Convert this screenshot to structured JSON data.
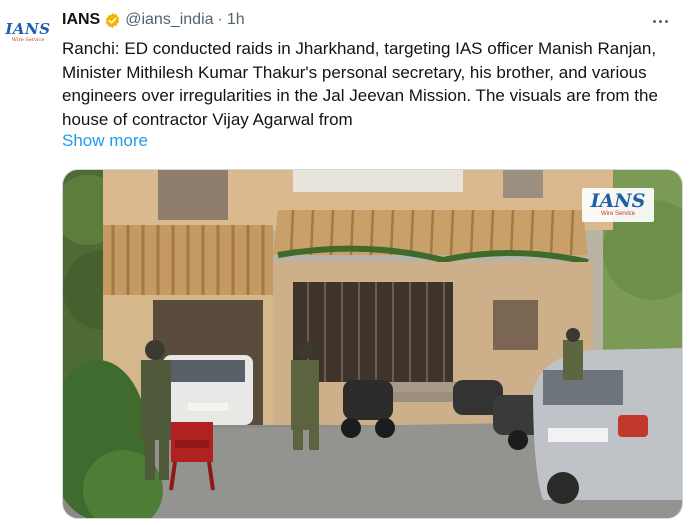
{
  "author": {
    "avatar_text": "IANS",
    "avatar_subtext": "Wire Service",
    "name": "IANS",
    "handle": "@ians_india",
    "separator": "·",
    "time": "1h",
    "verified_icon": "verified-badge-icon",
    "verified_color": "#f4b400"
  },
  "post": {
    "text": "Ranchi: ED conducted raids in Jharkhand, targeting IAS officer Manish Ranjan, Minister Mithilesh Kumar Thakur's personal secretary, his brother, and various engineers over irregularities in the Jal Jeevan Mission. The visuals are from the house of contractor Vijay Agarwal from",
    "show_more": "Show more",
    "link_color": "#1d9bf0"
  },
  "media": {
    "watermark_title": "IANS",
    "watermark_sub": "Wire Service",
    "scene": "raided house with security personnel, cars and scooters"
  },
  "menu": {
    "more_icon": "more-options-icon"
  }
}
